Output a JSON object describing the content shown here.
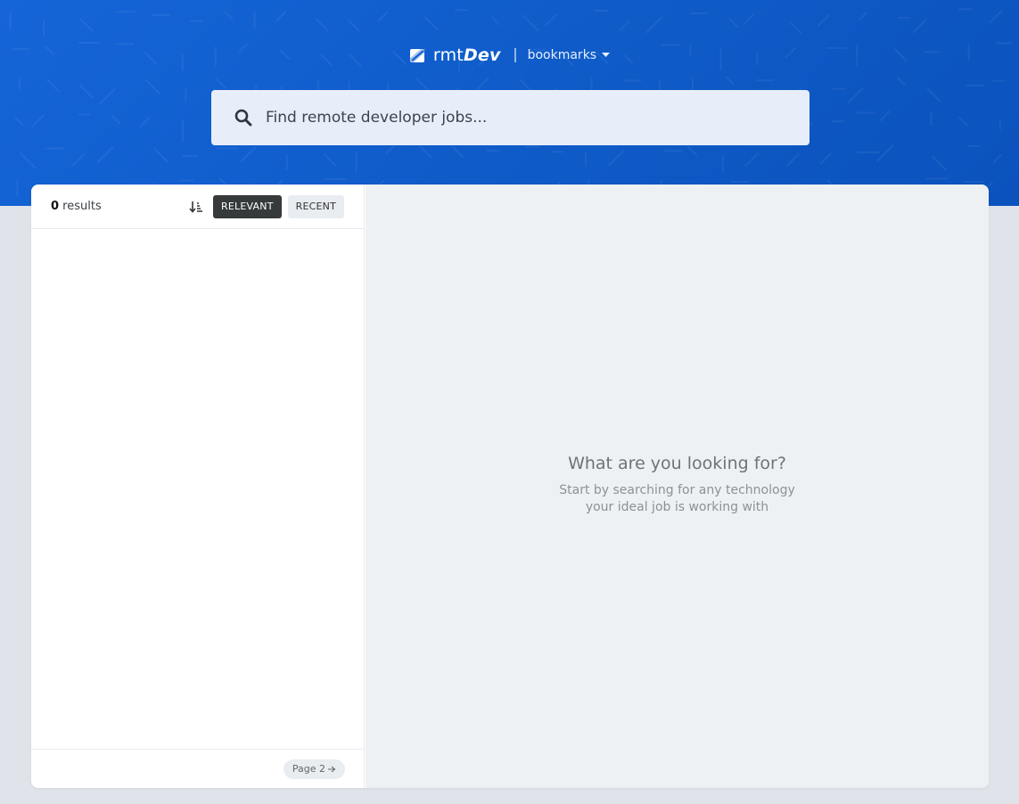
{
  "header": {
    "logo_prefix": "rmt",
    "logo_bold": "Dev",
    "bookmarks_label": "bookmarks",
    "colors": {
      "hero_start": "#1565d8",
      "hero_end": "#0b52bd"
    }
  },
  "search": {
    "placeholder": "Find remote developer jobs...",
    "value": ""
  },
  "sidebar": {
    "results_count": "0",
    "results_label": " results",
    "sort_relevant": "RELEVANT",
    "sort_recent": "RECENT",
    "sort_active": "RELEVANT",
    "pagination_label": "Page 2"
  },
  "details": {
    "empty_title": "What are you looking for?",
    "empty_line1": "Start by searching for any technology",
    "empty_line2": "your ideal job is working with"
  },
  "icons": {
    "logo": "logo-icon",
    "bookmarks_caret": "caret-down-icon",
    "search": "search-icon",
    "sort": "sort-icon",
    "page_arrow": "arrow-right-icon"
  }
}
